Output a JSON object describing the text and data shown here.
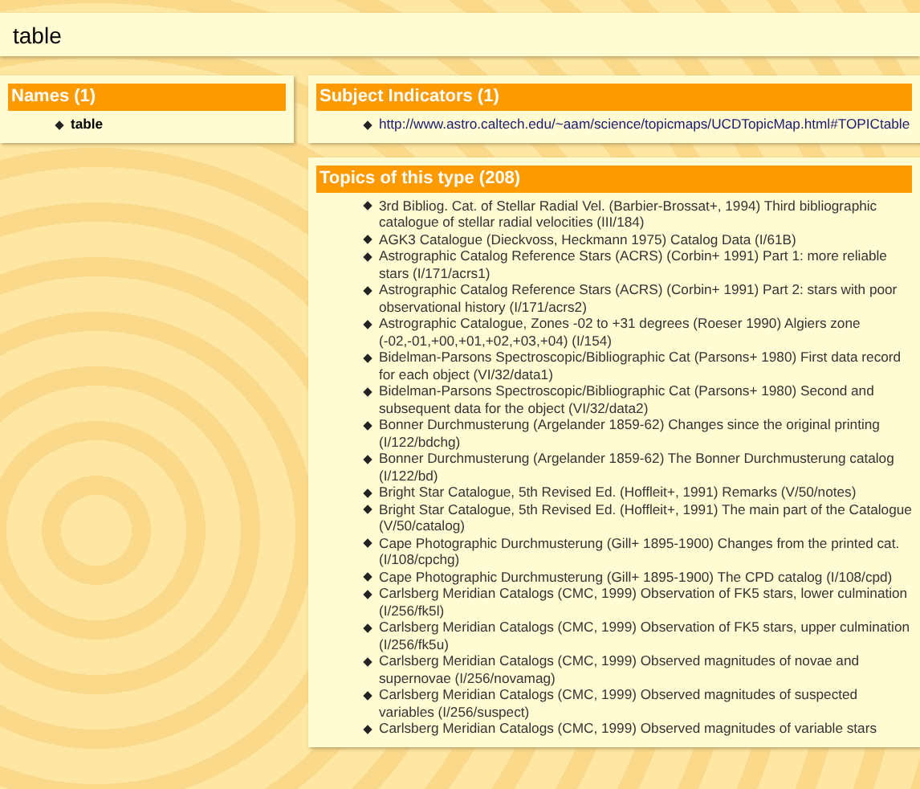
{
  "page_title": "table",
  "names": {
    "title": "Names (1)",
    "items": [
      "table"
    ]
  },
  "subject_indicators": {
    "title": "Subject Indicators (1)",
    "items": [
      "http://www.astro.caltech.edu/~aam/science/topicmaps/UCDTopicMap.html#TOPICtable"
    ]
  },
  "topics": {
    "title": "Topics of this type (208)",
    "items": [
      "3rd Bibliog. Cat. of Stellar Radial Vel. (Barbier-Brossat+, 1994) Third bibliographic catalogue of stellar radial velocities (III/184)",
      "AGK3 Catalogue (Dieckvoss, Heckmann 1975) Catalog Data (I/61B)",
      "Astrographic Catalog Reference Stars (ACRS) (Corbin+ 1991) Part 1: more reliable stars (I/171/acrs1)",
      "Astrographic Catalog Reference Stars (ACRS) (Corbin+ 1991) Part 2: stars with poor observational history (I/171/acrs2)",
      "Astrographic Catalogue, Zones -02 to +31 degrees (Roeser 1990) Algiers zone (-02,-01,+00,+01,+02,+03,+04) (I/154)",
      "Bidelman-Parsons Spectroscopic/Bibliographic Cat (Parsons+ 1980) First data record for each object (VI/32/data1)",
      "Bidelman-Parsons Spectroscopic/Bibliographic Cat (Parsons+ 1980) Second and subsequent data for the object (VI/32/data2)",
      "Bonner Durchmusterung (Argelander 1859-62) Changes since the original printing (I/122/bdchg)",
      "Bonner Durchmusterung (Argelander 1859-62) The Bonner Durchmusterung catalog (I/122/bd)",
      "Bright Star Catalogue, 5th Revised Ed. (Hoffleit+, 1991) Remarks (V/50/notes)",
      "Bright Star Catalogue, 5th Revised Ed. (Hoffleit+, 1991) The main part of the Catalogue (V/50/catalog)",
      "Cape Photographic Durchmusterung (Gill+ 1895-1900) Changes from the printed cat. (I/108/cpchg)",
      "Cape Photographic Durchmusterung (Gill+ 1895-1900) The CPD catalog (I/108/cpd)",
      "Carlsberg Meridian Catalogs (CMC, 1999) Observation of FK5 stars, lower culmination (I/256/fk5l)",
      "Carlsberg Meridian Catalogs (CMC, 1999) Observation of FK5 stars, upper culmination (I/256/fk5u)",
      "Carlsberg Meridian Catalogs (CMC, 1999) Observed magnitudes of novae and supernovae (I/256/novamag)",
      "Carlsberg Meridian Catalogs (CMC, 1999) Observed magnitudes of suspected variables (I/256/suspect)",
      "Carlsberg Meridian Catalogs (CMC, 1999) Observed magnitudes of variable stars"
    ]
  }
}
